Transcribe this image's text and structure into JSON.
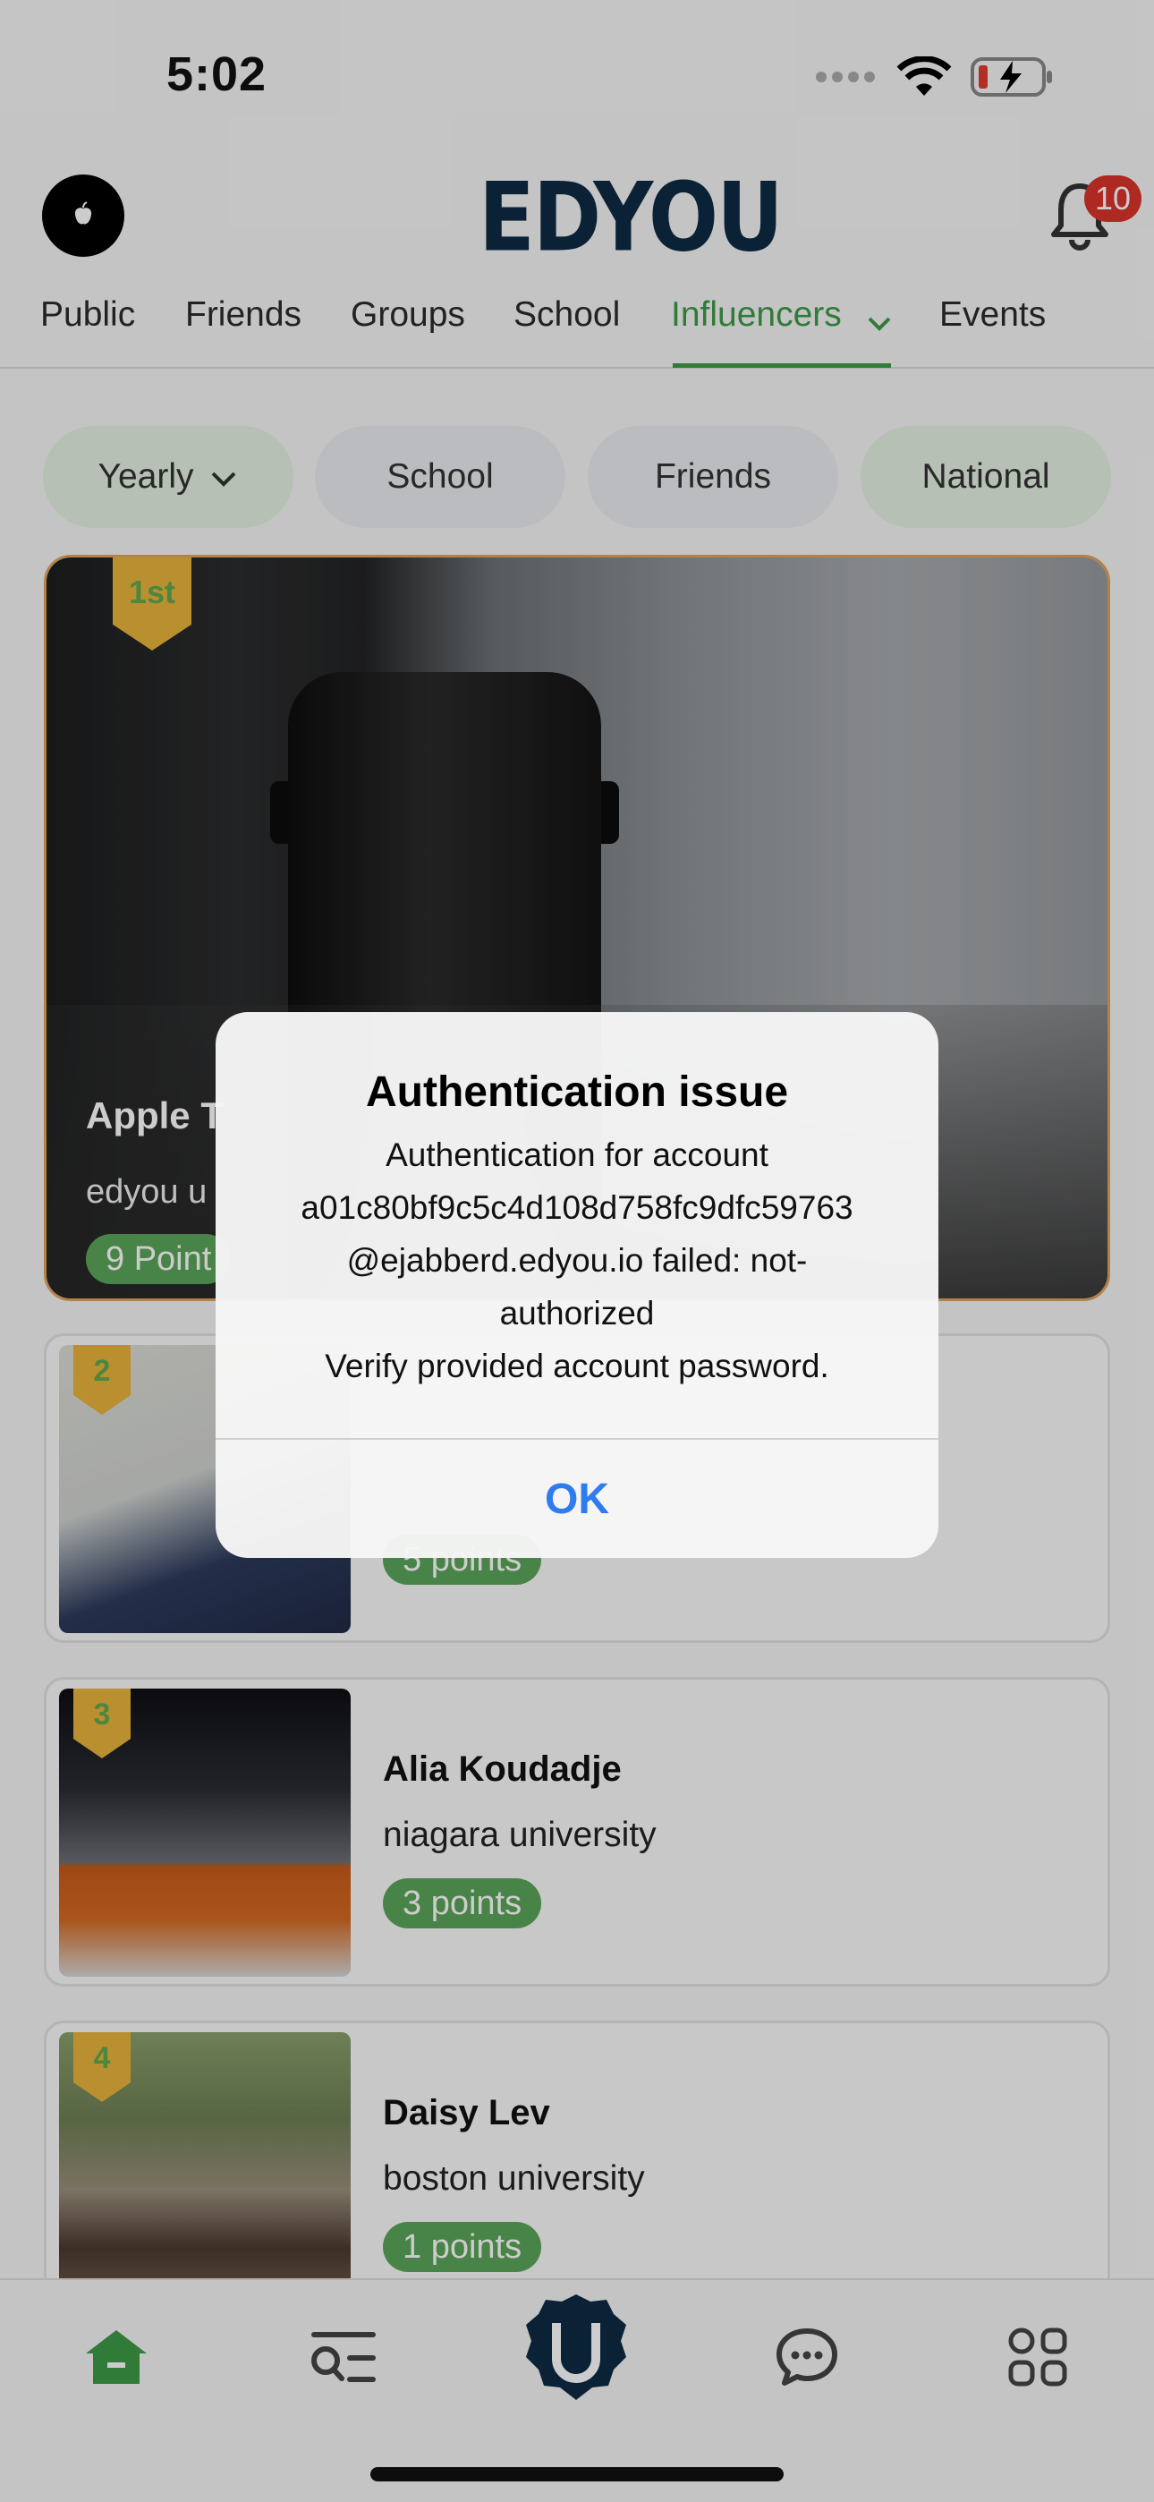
{
  "status_bar": {
    "time": "5:02"
  },
  "header": {
    "logo": "EDYOU",
    "notification_count": "10",
    "avatar_icon": "apple-logo-icon"
  },
  "tabs": [
    {
      "label": "Public"
    },
    {
      "label": "Friends"
    },
    {
      "label": "Groups"
    },
    {
      "label": "School"
    },
    {
      "label": "Influencers",
      "active": true
    },
    {
      "label": "Events"
    }
  ],
  "filters": [
    {
      "label": "Yearly",
      "dropdown": true
    },
    {
      "label": "School"
    },
    {
      "label": "Friends"
    },
    {
      "label": "National",
      "selected": true
    }
  ],
  "leaders": [
    {
      "rank": "1st",
      "name": "Apple T",
      "school": "edyou u",
      "points": "9 Point"
    },
    {
      "rank": "2",
      "name": "",
      "school": "",
      "points": "5 points"
    },
    {
      "rank": "3",
      "name": "Alia Koudadje",
      "school": "niagara university",
      "points": "3 points"
    },
    {
      "rank": "4",
      "name": "Daisy Lev",
      "school": "boston university",
      "points": "1 points"
    }
  ],
  "alert": {
    "title": "Authentication issue",
    "line1": "Authentication for account",
    "line2": "a01c80bf9c5c4d108d758fc9dfc59763",
    "line3": "@ejabberd.edyou.io failed: not-",
    "line4": "authorized",
    "line5": "Verify provided account password.",
    "ok_label": "OK"
  },
  "colors": {
    "accent_green": "#3e9a48",
    "brand_navy": "#0d2a44",
    "badge_red": "#d9342b",
    "rank_gold": "#e8b33c",
    "alert_blue": "#2f7bf0"
  },
  "bottom_nav": [
    "home-icon",
    "search-list-icon",
    "edyou-badge-icon",
    "chat-icon",
    "apps-grid-icon"
  ]
}
